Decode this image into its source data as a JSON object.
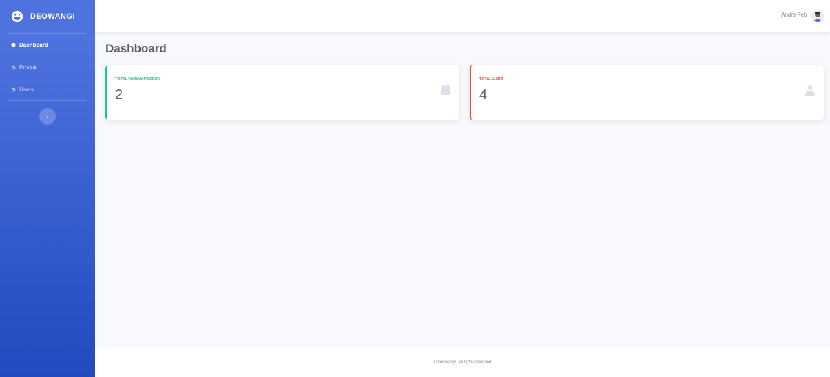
{
  "brand": {
    "name": "DEOWANGI"
  },
  "sidebar": {
    "items": [
      {
        "label": "Dashboard",
        "icon": "tachometer-icon",
        "active": true
      },
      {
        "label": "Produk",
        "icon": "cog-icon",
        "active": false
      },
      {
        "label": "Users",
        "icon": "cog-icon",
        "active": false
      }
    ],
    "toggle_icon": "chevron-left-icon"
  },
  "topbar": {
    "user_name": "Andre Feb",
    "avatar_icon": "user-avatar"
  },
  "page": {
    "title": "Dashboard"
  },
  "cards": [
    {
      "label": "TOTAL VARIAN PRODUK",
      "value": "2",
      "accent": "#1cc88a",
      "icon": "box-icon"
    },
    {
      "label": "TOTAL USER",
      "value": "4",
      "accent": "#e74a3b",
      "icon": "user-icon"
    }
  ],
  "footer": {
    "text": "© Deowangi. All rigths reserved"
  },
  "colors": {
    "primary": "#4e73df",
    "primary_dark": "#224abe",
    "success": "#1cc88a",
    "danger": "#e74a3b",
    "muted_text": "#858796"
  }
}
